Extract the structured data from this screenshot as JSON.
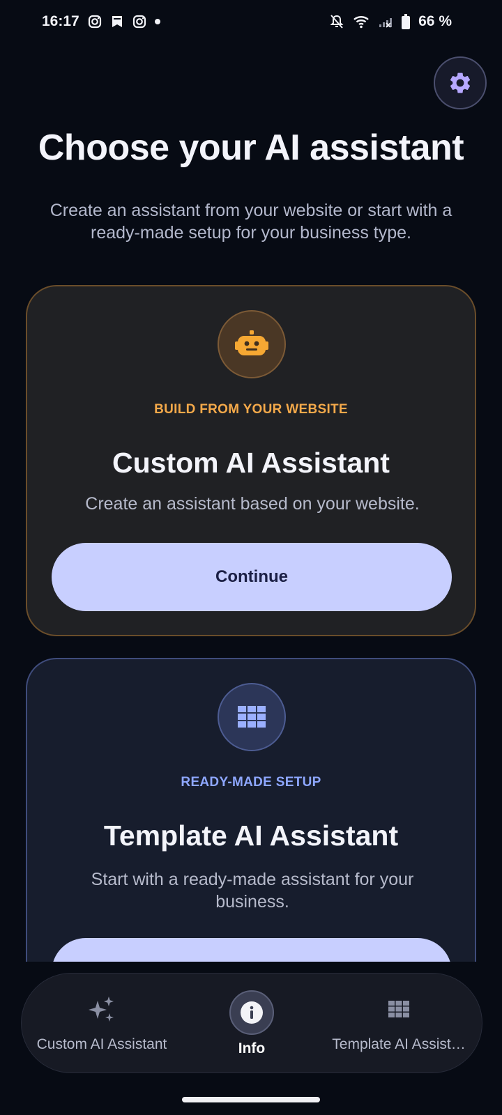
{
  "status_bar": {
    "time": "16:17",
    "battery": "66 %",
    "icons": [
      "instagram-icon",
      "bookmark-icon",
      "instagram-icon",
      "dot-icon",
      "mute-icon",
      "wifi-icon",
      "signal-icon",
      "battery-icon"
    ]
  },
  "header": {
    "title": "Choose your AI assistant",
    "subtitle": "Create an assistant from your website or start with a ready-made setup for your business type.",
    "settings_icon": "gear-icon"
  },
  "cards": [
    {
      "icon": "robot-icon",
      "eyebrow": "BUILD FROM YOUR WEBSITE",
      "title": "Custom AI Assistant",
      "description": "Create an assistant based on your website.",
      "button_label": "Continue",
      "accent": "#f4a94a"
    },
    {
      "icon": "grid-icon",
      "eyebrow": "READY-MADE SETUP",
      "title": "Template AI Assistant",
      "description": "Start with a ready-made assistant for your business.",
      "accent": "#8ea7ff"
    }
  ],
  "bottom_nav": {
    "items": [
      {
        "label": "Custom AI Assistant",
        "icon": "sparkles-icon"
      },
      {
        "label": "Info",
        "icon": "info-icon",
        "selected": true
      },
      {
        "label": "Template AI Assist…",
        "icon": "grid-icon"
      }
    ]
  },
  "colors": {
    "background": "#070b14",
    "button": "#c8cfff",
    "button_text": "#1b1f45"
  }
}
